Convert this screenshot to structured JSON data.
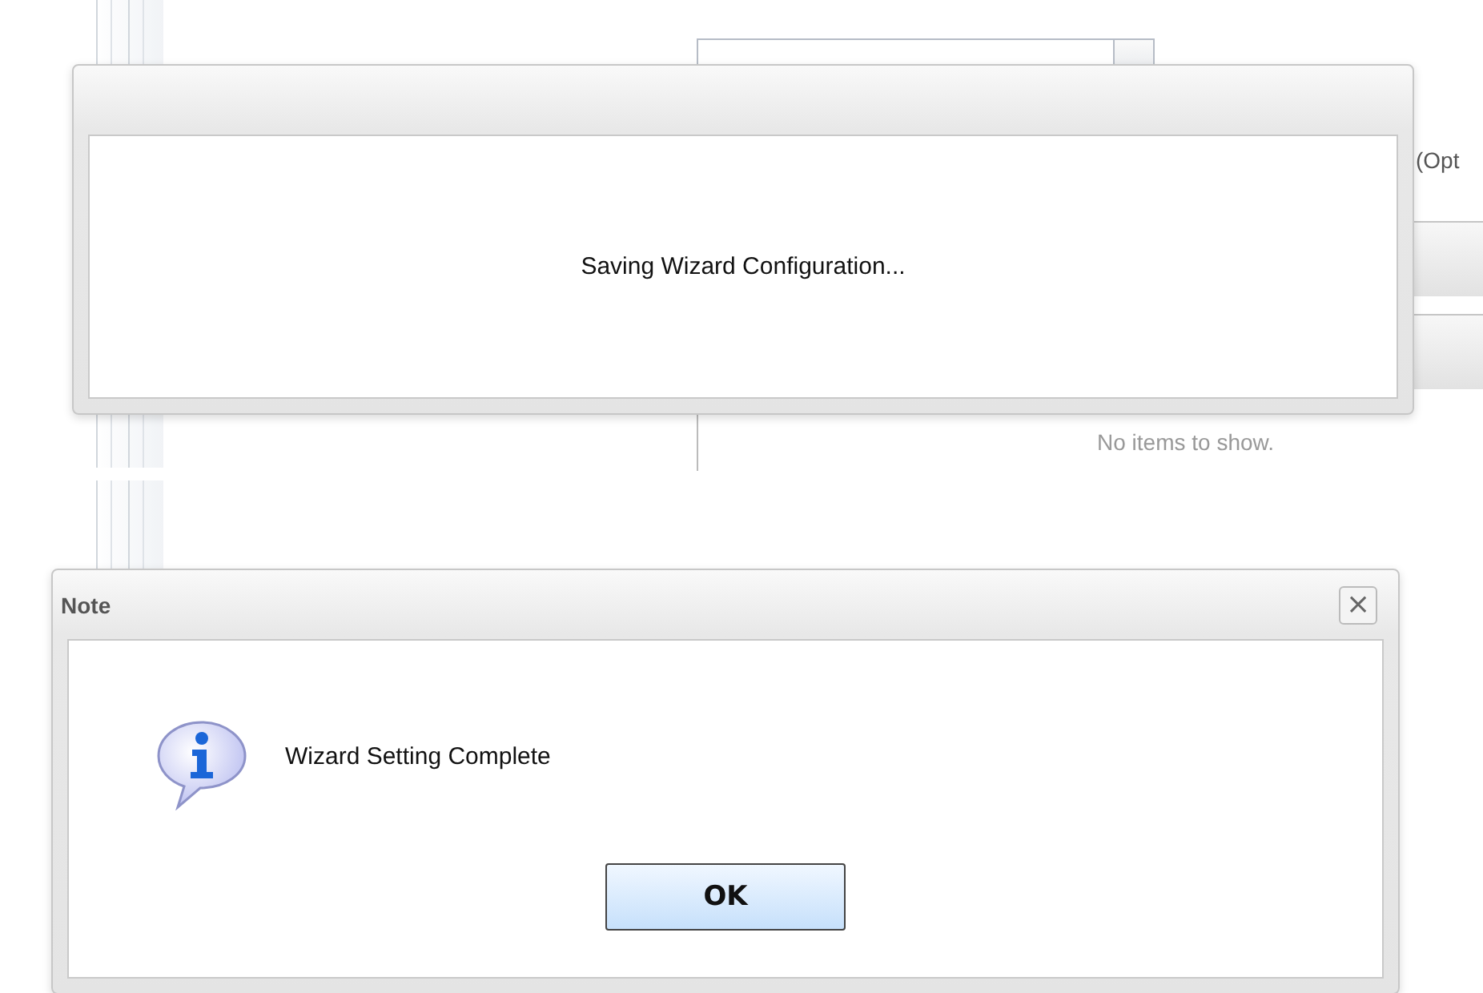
{
  "background": {
    "side_text": "(Opt",
    "empty_text": "No items to show."
  },
  "progress_dialog": {
    "message": "Saving Wizard Configuration..."
  },
  "note_dialog": {
    "title": "Note",
    "close": "×",
    "message": "Wizard Setting Complete",
    "buttons": [
      "OK"
    ]
  }
}
